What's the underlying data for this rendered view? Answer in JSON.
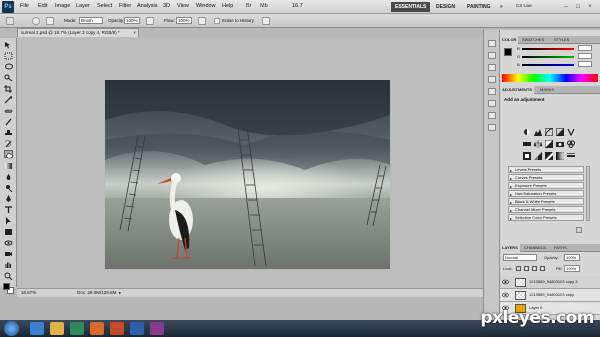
{
  "app": {
    "logo": "Ps",
    "menu": [
      "File",
      "Edit",
      "Image",
      "Layer",
      "Select",
      "Filter",
      "Analysis",
      "3D",
      "View",
      "Window",
      "Help"
    ],
    "zoom_display": "16.7",
    "workspaces": [
      "ESSENTIALS",
      "DESIGN",
      "PAINTING",
      "»"
    ],
    "cs_live": "CS Live"
  },
  "options_bar": {
    "mode_label": "Mode:",
    "mode_value": "Brush",
    "opacity_label": "Opacity:",
    "opacity_value": "100%",
    "flow_label": "Flow:",
    "flow_value": "100%",
    "erase_to_history": "Erase to History"
  },
  "document": {
    "tab_title": "surreal 2.psd @ 16.7% (Layer 2 copy 4, RGB/8) *"
  },
  "status_bar": {
    "zoom": "16.67%",
    "doc_size": "Doc: 28.0M/139.6M"
  },
  "color_panel": {
    "tabs": [
      "COLOR",
      "SWATCHES",
      "STYLES"
    ],
    "channels": [
      "R",
      "G",
      "B"
    ],
    "colors": {
      "foreground": "#000000",
      "background": "#ffffff"
    }
  },
  "adjustments_panel": {
    "tabs": [
      "ADJUSTMENTS",
      "MASKS"
    ],
    "heading": "Add an adjustment",
    "presets": [
      "Levels Presets",
      "Curves Presets",
      "Exposure Presets",
      "Hue/Saturation Presets",
      "Black & White Presets",
      "Channel Mixer Presets",
      "Selective Color Presets"
    ]
  },
  "layers_panel": {
    "tabs": [
      "LAYERS",
      "CHANNELS",
      "PATHS"
    ],
    "blend_mode": "Normal",
    "opacity_label": "Opacity:",
    "opacity_value": "100%",
    "lock_label": "Lock:",
    "fill_label": "Fill:",
    "fill_value": "100%",
    "layers": [
      {
        "name": "1213589_94803103 copy 3"
      },
      {
        "name": "1213589_94803103 copy"
      },
      {
        "name": "Layer 0"
      }
    ]
  },
  "taskbar": {
    "accent_color": "#2a3a4c"
  },
  "watermark": {
    "text": "pxleyes.com"
  }
}
